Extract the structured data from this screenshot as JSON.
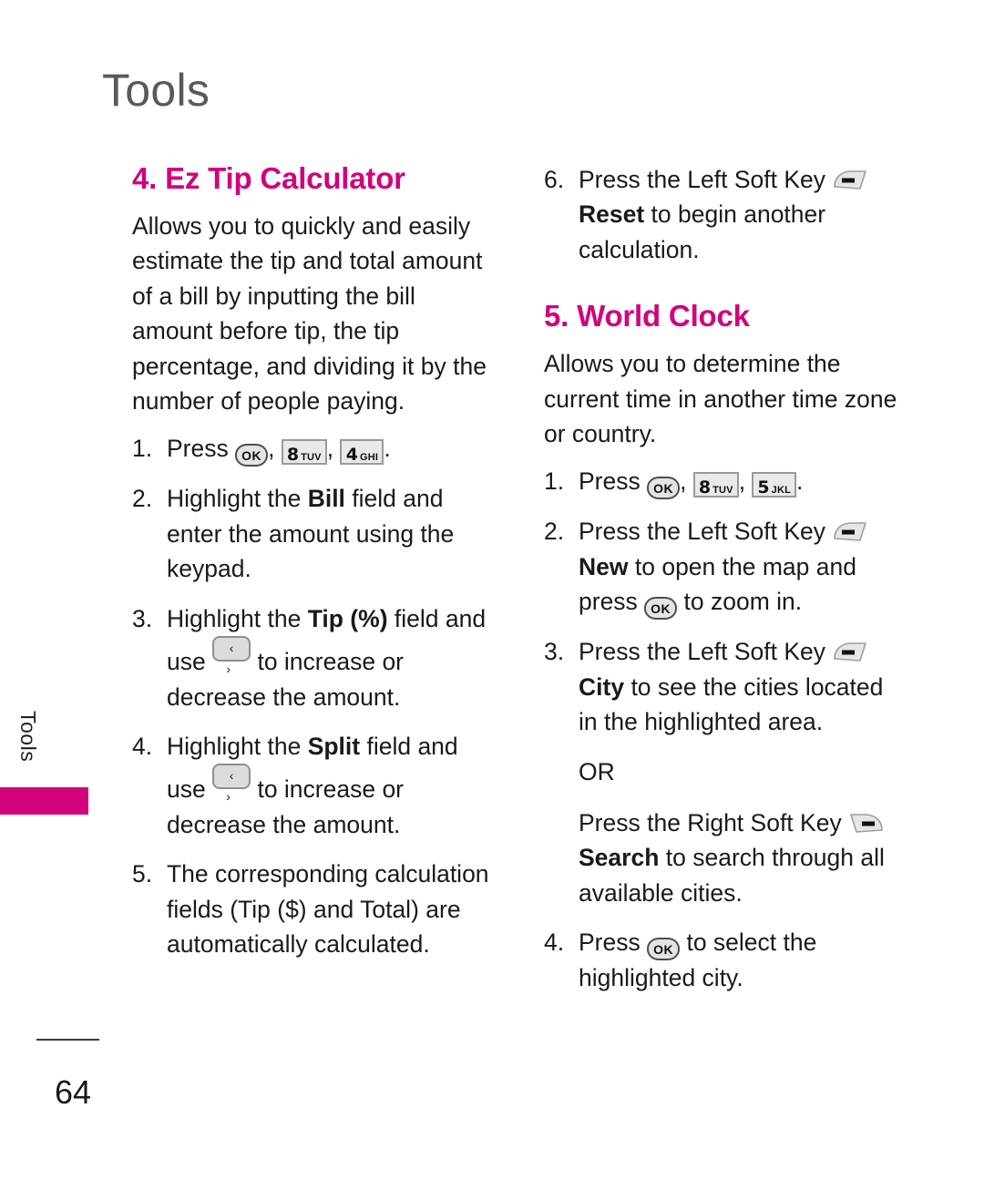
{
  "page": {
    "chapter_title": "Tools",
    "side_tab_label": "Tools",
    "page_number": "64",
    "accent_color": "#d2017c",
    "title_color": "#58595b",
    "text_color": "#1a1a1a"
  },
  "icons": {
    "ok_key": "ok-key-icon",
    "key_8": {
      "digit": "8",
      "letters": "TUV"
    },
    "key_4": {
      "digit": "4",
      "letters": "GHI"
    },
    "key_5": {
      "digit": "5",
      "letters": "JKL"
    },
    "nav_key": "‹ ›",
    "left_soft_key": "left-soft-key-icon",
    "right_soft_key": "right-soft-key-icon"
  },
  "left_column": {
    "heading": "4. Ez Tip Calculator",
    "intro": "Allows you to quickly and easily estimate the tip and total amount of a bill by inputting the bill amount before tip, the tip percentage, and dividing it by the number of people paying.",
    "steps": [
      {
        "num": "1.",
        "parts": [
          {
            "type": "text",
            "value": "Press "
          },
          {
            "type": "icon",
            "value": "ok_key"
          },
          {
            "type": "text",
            "value": ", "
          },
          {
            "type": "icon",
            "value": "key_8"
          },
          {
            "type": "text",
            "value": ", "
          },
          {
            "type": "icon",
            "value": "key_4"
          },
          {
            "type": "text",
            "value": "."
          }
        ],
        "text_pre": "Press ",
        "text_mid1": ", ",
        "text_mid2": ", ",
        "text_end": "."
      },
      {
        "num": "2.",
        "text_pre": "Highlight the ",
        "bold": "Bill",
        "text_post": " field and enter the amount using the keypad."
      },
      {
        "num": "3.",
        "text_pre": "Highlight the ",
        "bold": "Tip (%)",
        "text_mid": " field and use ",
        "text_post": " to increase or decrease the amount."
      },
      {
        "num": "4.",
        "text_pre": "Highlight the ",
        "bold": "Split",
        "text_mid": " field and use ",
        "text_post": " to increase or decrease the amount."
      },
      {
        "num": "5.",
        "text": "The corresponding calculation fields (Tip ($) and Total) are automatically calculated."
      }
    ]
  },
  "right_column": {
    "step6": {
      "num": "6.",
      "text_pre": "Press the Left Soft Key ",
      "bold": "Reset",
      "text_post": " to begin another calculation."
    },
    "heading": "5. World Clock",
    "intro": "Allows you to determine the current time in another time zone or country.",
    "steps": [
      {
        "num": "1.",
        "text_pre": "Press ",
        "text_mid1": ", ",
        "text_mid2": ", ",
        "text_end": "."
      },
      {
        "num": "2.",
        "text_pre": "Press the Left Soft Key ",
        "bold": "New",
        "text_mid": " to open the map and press ",
        "text_post": " to zoom in."
      },
      {
        "num": "3.",
        "text_pre": "Press the Left Soft Key ",
        "bold": "City",
        "text_post": " to see the cities located in the highlighted area."
      }
    ],
    "or_label": "OR",
    "or_block": {
      "text_pre": "Press the Right Soft Key ",
      "bold": "Search",
      "text_post": " to search through all available cities."
    },
    "step4": {
      "num": "4.",
      "text_pre": "Press ",
      "text_post": " to select the highlighted city."
    }
  }
}
